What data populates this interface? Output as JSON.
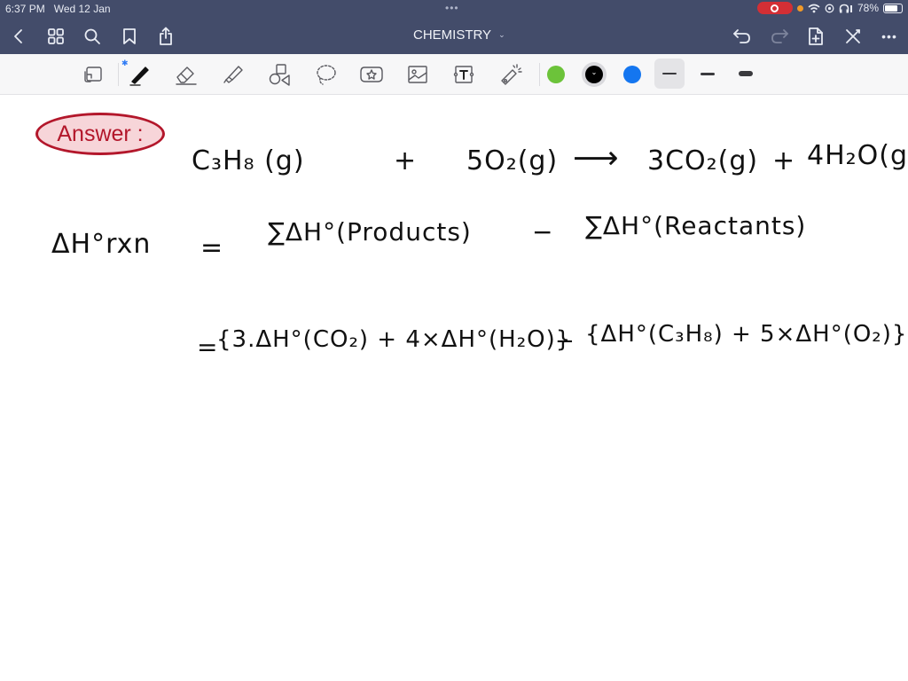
{
  "status_bar": {
    "time": "6:37 PM",
    "date": "Wed 12 Jan",
    "center_dots": "•••",
    "battery_percent": "78%",
    "battery_level": 0.78,
    "recording": true,
    "recording_color": "#d32f35"
  },
  "nav": {
    "title": "CHEMISTRY",
    "title_chevron": "⌄",
    "left_icons": [
      "back-icon",
      "grid-icon",
      "search-icon",
      "bookmark-icon",
      "share-icon"
    ],
    "right_icons": [
      "undo-icon",
      "redo-icon",
      "add-page-icon",
      "close-icon",
      "more-icon"
    ],
    "more_label": "•••"
  },
  "toolbar": {
    "tools": [
      "toolbar-toggle",
      "pen",
      "eraser",
      "highlighter",
      "shapes",
      "lasso",
      "elements",
      "image",
      "text",
      "laser-pointer"
    ],
    "bluetooth_mark": "✱",
    "active_tool": "pen",
    "colors": [
      {
        "name": "green",
        "hex": "#6cc33a"
      },
      {
        "name": "black",
        "hex": "#000000",
        "selected": true
      },
      {
        "name": "blue",
        "hex": "#1476f0"
      }
    ],
    "selected_color_chevron": "⌄",
    "thickness_options": [
      "thin",
      "medium",
      "thick"
    ],
    "selected_thickness": "thin"
  },
  "note": {
    "badge": "Answer :",
    "reaction": {
      "reactant1": "C₃H₈ (g)",
      "plus1": "+",
      "reactant2": "5O₂(g)",
      "arrow": "⟶",
      "product1": "3CO₂(g)",
      "plus2": "+",
      "product2": "4H₂O(g"
    },
    "enthalpy_line": {
      "lhs": "ΔH°rxn",
      "eq": "=",
      "products_term": "∑ΔH°(Products)",
      "minus": "−",
      "reactants_term": "∑ΔH°(Reactants)"
    },
    "expansion_line": {
      "eq": "=",
      "products_group": "{3.ΔH°(CO₂) + 4×ΔH°(H₂O)}",
      "minus": "−",
      "reactants_group": "{ΔH°(C₃H₈) + 5×ΔH°(O₂)}"
    }
  }
}
